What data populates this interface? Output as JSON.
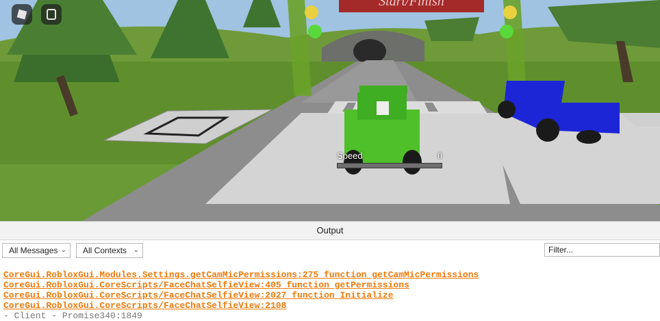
{
  "game": {
    "banner_text": "Start/Finish",
    "speed_label": "Speed",
    "speed_value": "0",
    "speed_fraction": 0.0
  },
  "output": {
    "title": "Output",
    "messages_filter": "All Messages",
    "contexts_filter": "All Contexts",
    "filter_placeholder": "Filter...",
    "lines": [
      {
        "text": "CoreGui.RobloxGui.Modules.Settings.getCamMicPermissions:275 function getCamMicPermissions",
        "kind": "link"
      },
      {
        "text": "CoreGui.RobloxGui.CoreScripts/FaceChatSelfieView:405 function getPermissions",
        "kind": "link"
      },
      {
        "text": "CoreGui.RobloxGui.CoreScripts/FaceChatSelfieView:2027 function Initialize",
        "kind": "link"
      },
      {
        "text": "CoreGui.RobloxGui.CoreScripts/FaceChatSelfieView:2108",
        "kind": "link"
      },
      {
        "text": "  -  Client - Promise340:1849",
        "kind": "plain"
      }
    ]
  },
  "colors": {
    "sky": "#9fc3e0",
    "grass": "#5f8f2c",
    "road": "#8d8d8d",
    "pad": "#d4d4d4",
    "banner": "#a42a2a",
    "green_car": "#4fbf2a",
    "blue_car": "#1c26d6",
    "link": "#f07a0a"
  },
  "icons": [
    "roblox-menu-icon",
    "chat-icon",
    "chevron-down-icon"
  ]
}
